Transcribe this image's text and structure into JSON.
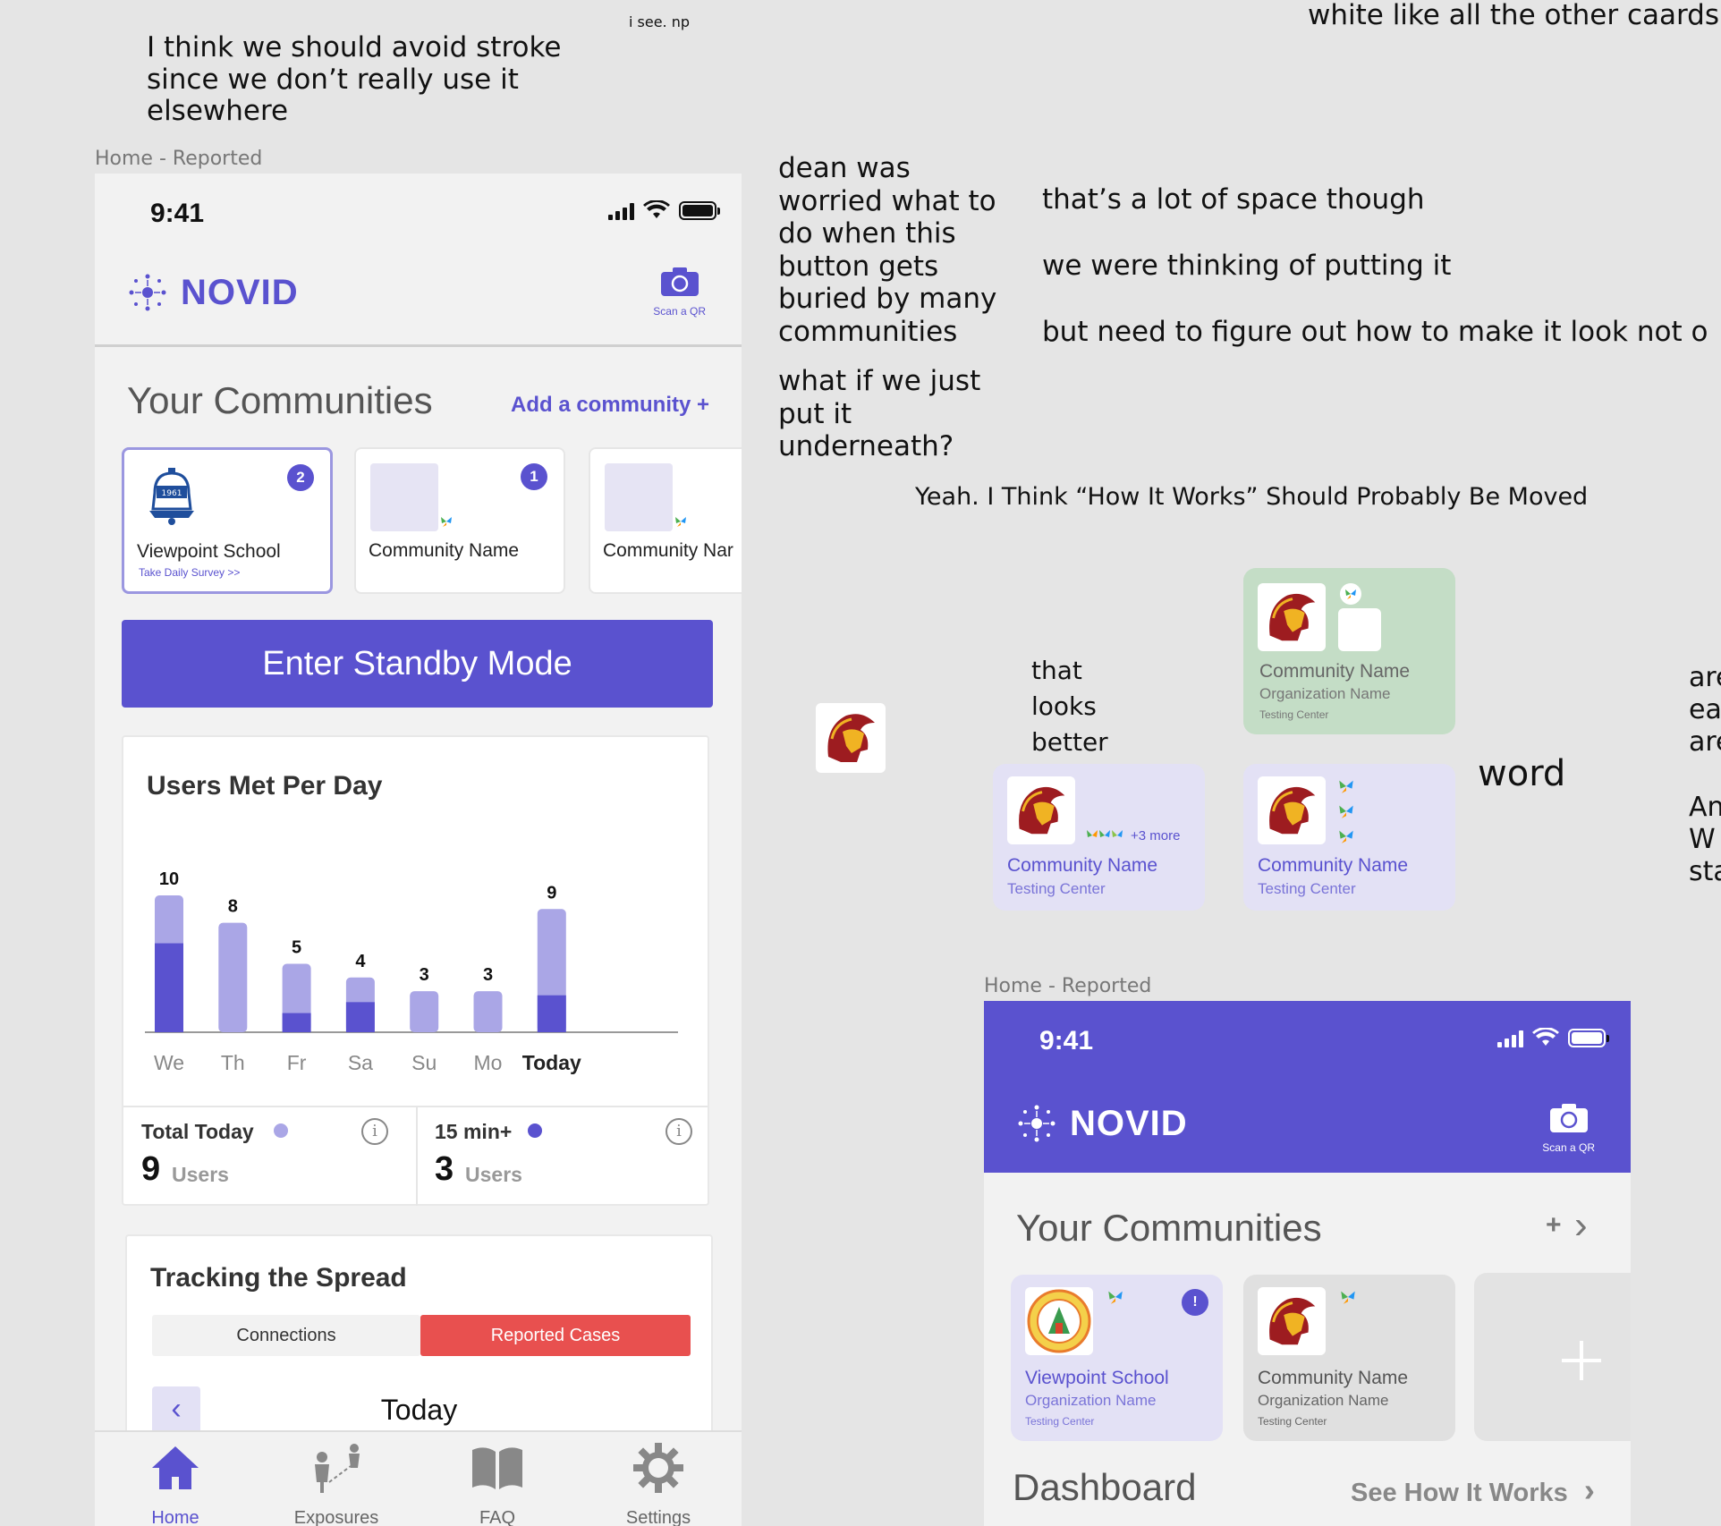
{
  "comments": {
    "stroke": "I think we should avoid stroke\nsince we don’t really use it\nelsewhere",
    "isee": "i see. np",
    "white": "white like all the other caards",
    "dean": "dean was\nworried what to\ndo when this\nbutton gets\nburied by many\ncommunities",
    "space": "that’s a lot of space though",
    "putting": "we were thinking of putting it",
    "figure": "but need to figure out how to make it look not o",
    "underneath": "what if we just\nput it\nunderneath?",
    "howitworks": "Yeah. I Think “How It Works” Should Probably Be Moved",
    "looks_better": "that\nlooks\nbetter",
    "word": "word",
    "edge_1": "are\neas\nare",
    "edge_2": "An\nW\nsta"
  },
  "frame1": {
    "label": "Home - Reported",
    "status_time": "9:41",
    "app_name": "NOVID",
    "scan_label": "Scan a QR",
    "communities_title": "Your Communities",
    "add_community": "Add a community +",
    "communities": [
      {
        "name": "Viewpoint School",
        "sub": "Take Daily Survey >>",
        "badge": "2"
      },
      {
        "name": "Community Name",
        "sub": "",
        "badge": "1"
      },
      {
        "name": "Community Nar",
        "sub": "",
        "badge": ""
      }
    ],
    "standby_button": "Enter Standby Mode",
    "users_met_title": "Users Met Per Day",
    "total_today_label": "Total Today",
    "total_today_value": "9",
    "total_today_unit": "Users",
    "fifteen_label": "15 min+",
    "fifteen_value": "3",
    "fifteen_unit": "Users",
    "info_glyph": "i",
    "tracking_title": "Tracking the Spread",
    "seg_connections": "Connections",
    "seg_reported": "Reported Cases",
    "today_label": "Today",
    "prev_glyph": "‹",
    "tabs": [
      "Home",
      "Exposures",
      "FAQ",
      "Settings"
    ]
  },
  "chart_data": {
    "type": "bar",
    "title": "Users Met Per Day",
    "categories": [
      "We",
      "Th",
      "Fr",
      "Sa",
      "Su",
      "Mo",
      "Today"
    ],
    "series": [
      {
        "name": "Total Today",
        "values": [
          10,
          8,
          5,
          4,
          3,
          3,
          9
        ]
      },
      {
        "name": "15 min+",
        "values": [
          6.5,
          0,
          1.4,
          2.2,
          0,
          0,
          2.7
        ]
      }
    ],
    "data_labels": [
      "10",
      "8",
      "5",
      "4",
      "3",
      "3",
      "9"
    ],
    "ylim": [
      0,
      10
    ],
    "colors": {
      "total": "#aaa6e6",
      "min15": "#5a52cf"
    }
  },
  "floating_cards": {
    "green": {
      "name": "Community Name",
      "org": "Organization Name",
      "tiny": "Testing Center"
    },
    "purple_a": {
      "name": "Community Name",
      "sub": "Testing Center",
      "more": "+3 more"
    },
    "purple_b": {
      "name": "Community Name",
      "sub": "Testing Center"
    }
  },
  "frame2": {
    "label": "Home - Reported",
    "status_time": "9:41",
    "app_name": "NOVID",
    "scan_label": "Scan a QR",
    "communities_title": "Your Communities",
    "plus_glyph": "+",
    "chevron_glyph": "›",
    "badge": "!",
    "cards": [
      {
        "name": "Viewpoint School",
        "org": "Organization Name",
        "tiny": "Testing Center"
      },
      {
        "name": "Community Name",
        "org": "Organization Name",
        "tiny": "Testing Center"
      }
    ],
    "dashboard_title": "Dashboard",
    "see_how": "See How It Works"
  },
  "colors": {
    "accent": "#5a52cf",
    "accent_light": "#aaa6e6",
    "reported": "#e8504f",
    "green_card": "#c4ddc6",
    "purple_card": "#e3e1f5",
    "usc_red": "#9d1c20",
    "usc_gold": "#f0b323"
  }
}
